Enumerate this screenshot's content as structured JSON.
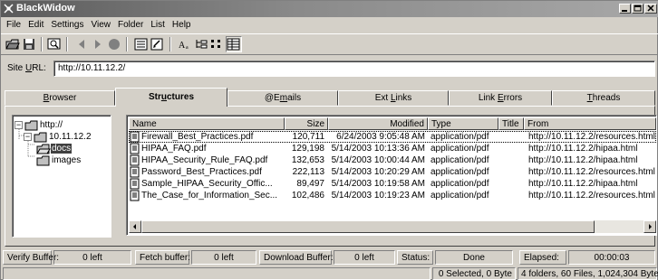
{
  "window": {
    "title": "BlackWidow"
  },
  "menu": [
    "File",
    "Edit",
    "Settings",
    "View",
    "Folder",
    "List",
    "Help"
  ],
  "site": {
    "label_prefix": "Site ",
    "label_underlined": "U",
    "label_suffix": "RL:",
    "url": "http://10.11.12.2/"
  },
  "tabs": [
    {
      "pre": "",
      "u": "B",
      "post": "rowser",
      "active": false
    },
    {
      "pre": "Str",
      "u": "u",
      "post": "ctures",
      "active": true
    },
    {
      "pre": "@E",
      "u": "m",
      "post": "ails",
      "active": false
    },
    {
      "pre": "Ext ",
      "u": "L",
      "post": "inks",
      "active": false
    },
    {
      "pre": "Link ",
      "u": "E",
      "post": "rrors",
      "active": false
    },
    {
      "pre": "",
      "u": "T",
      "post": "hreads",
      "active": false
    }
  ],
  "tree": [
    {
      "label": "http://",
      "toggle": "−"
    },
    {
      "label": "10.11.12.2",
      "toggle": "−"
    },
    {
      "label": "docs",
      "toggle": "",
      "selected": true
    },
    {
      "label": "images",
      "toggle": ""
    }
  ],
  "columns": [
    "Name",
    "Size",
    "Modified",
    "Type",
    "Title",
    "From"
  ],
  "rows": [
    {
      "name": "Firewall_Best_Practices.pdf",
      "size": "120,711",
      "modified": "6/24/2003  9:05:48 AM",
      "type": "application/pdf",
      "title": "",
      "from": "http://10.11.12.2/resources.html"
    },
    {
      "name": "HIPAA_FAQ.pdf",
      "size": "129,198",
      "modified": "5/14/2003  10:13:36 AM",
      "type": "application/pdf",
      "title": "",
      "from": "http://10.11.12.2/hipaa.html"
    },
    {
      "name": "HIPAA_Security_Rule_FAQ.pdf",
      "size": "132,653",
      "modified": "5/14/2003  10:00:44 AM",
      "type": "application/pdf",
      "title": "",
      "from": "http://10.11.12.2/hipaa.html"
    },
    {
      "name": "Password_Best_Practices.pdf",
      "size": "222,113",
      "modified": "5/14/2003  10:20:29 AM",
      "type": "application/pdf",
      "title": "",
      "from": "http://10.11.12.2/resources.html"
    },
    {
      "name": "Sample_HIPAA_Security_Offic...",
      "size": "89,497",
      "modified": "5/14/2003  10:19:58 AM",
      "type": "application/pdf",
      "title": "",
      "from": "http://10.11.12.2/hipaa.html"
    },
    {
      "name": "The_Case_for_Information_Sec...",
      "size": "102,486",
      "modified": "5/14/2003  10:19:23 AM",
      "type": "application/pdf",
      "title": "",
      "from": "http://10.11.12.2/resources.html"
    }
  ],
  "buffers": {
    "verify_label": "Verify Buffer:",
    "verify_value": "0 left",
    "fetch_label": "Fetch buffer:",
    "fetch_value": "0 left",
    "download_label": "Download Buffer:",
    "download_value": "0 left",
    "status_label": "Status:",
    "status_value": "Done",
    "elapsed_label": "Elapsed:",
    "elapsed_value": "00:00:03"
  },
  "statusbar": {
    "selection": "0 Selected, 0 Byte",
    "summary": "4 folders, 60 Files, 1,024,304 Bytes"
  },
  "toolbar_icons": [
    "open-folder-icon",
    "save-icon",
    "find-icon",
    "back-icon",
    "forward-icon",
    "stop-icon",
    "filter-icon",
    "scan-icon",
    "font-size-icon",
    "tree-view-icon",
    "list-view-icon",
    "details-view-icon"
  ]
}
